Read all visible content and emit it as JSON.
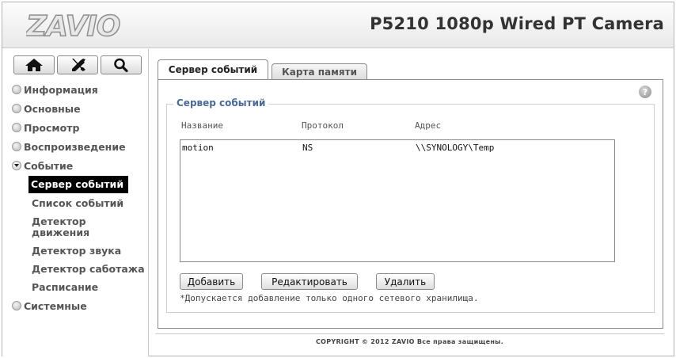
{
  "header": {
    "logo_text": "ZAVIO",
    "camera_title": "P5210 1080p Wired PT Camera"
  },
  "toolbar": {
    "icons": [
      "home-icon",
      "tools-icon",
      "search-icon"
    ]
  },
  "sidebar": {
    "items": [
      {
        "label": "Информация"
      },
      {
        "label": "Основные"
      },
      {
        "label": "Просмотр"
      },
      {
        "label": "Воспроизведение"
      },
      {
        "label": "Событие"
      },
      {
        "label": "Системные"
      }
    ],
    "event_submenu": [
      {
        "label": "Сервер событий"
      },
      {
        "label": "Список событий"
      },
      {
        "label": "Детектор движения"
      },
      {
        "label": "Детектор звука"
      },
      {
        "label": "Детектор саботажа"
      },
      {
        "label": "Расписание"
      }
    ]
  },
  "tabs": [
    {
      "label": "Сервер событий"
    },
    {
      "label": "Карта памяти"
    }
  ],
  "panel": {
    "legend": "Сервер событий",
    "help_glyph": "?",
    "columns": [
      "Название",
      "Протокол",
      "Адрес"
    ],
    "rows": [
      {
        "name": "motion",
        "protocol": "NS",
        "address": "\\\\SYNOLOGY\\Temp"
      }
    ],
    "buttons": {
      "add": "Добавить",
      "edit": "Редактировать",
      "delete": "Удалить"
    },
    "note": "*Допускается добавление только одного сетевого хранилища."
  },
  "footer": {
    "copyright": "COPYRIGHT © 2012 ZAVIO Все права защищены."
  },
  "colors": {
    "legend": "#4a6a9a",
    "active_menu_bg": "#000000"
  }
}
